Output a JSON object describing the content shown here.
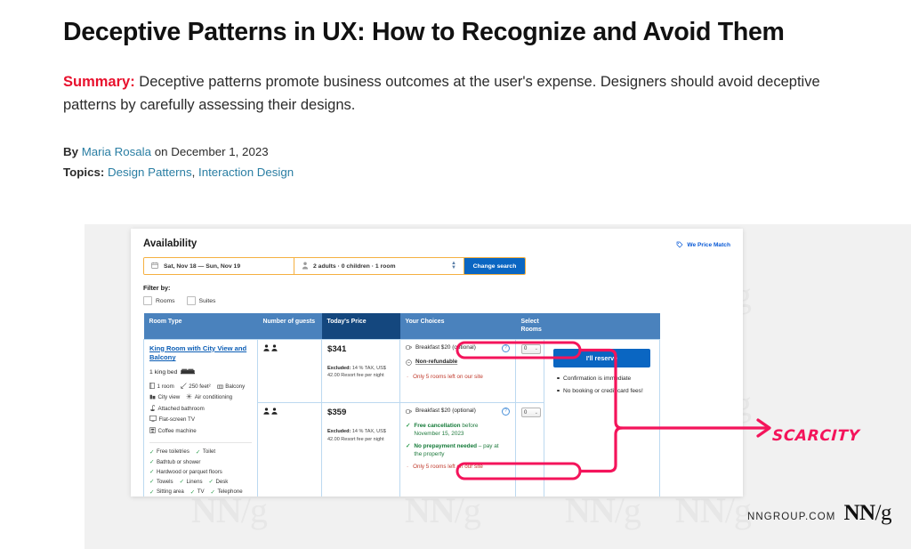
{
  "article": {
    "title": "Deceptive Patterns in UX: How to Recognize and Avoid Them",
    "summary_label": "Summary:",
    "summary_text": " Deceptive patterns promote business outcomes at the user's expense. Designers should avoid deceptive patterns by carefully assessing their designs.",
    "by_label": "By",
    "author": "Maria Rosala",
    "date_prefix": " on ",
    "date": "December 1, 2023",
    "topics_label": "Topics:",
    "topic_1": "Design Patterns",
    "topic_separator": ", ",
    "topic_2": "Interaction Design"
  },
  "brand": {
    "url": "NNGROUP.COM",
    "logo_nn": "NN",
    "logo_slash": "/",
    "logo_g": "g",
    "watermark": "NN",
    "watermark_slash": "/g"
  },
  "annotation": {
    "label": "SCARCITY",
    "color": "#f4145b"
  },
  "screenshot": {
    "availability_title": "Availability",
    "price_match": "We Price Match",
    "search": {
      "dates": "Sat, Nov 18 — Sun, Nov 19",
      "guests": "2 adults · 0 children · 1 room",
      "change_button": "Change search"
    },
    "filter": {
      "title": "Filter by:",
      "options": [
        "Rooms",
        "Suites"
      ]
    },
    "table": {
      "headers": {
        "room_type": "Room Type",
        "guests": "Number of guests",
        "price": "Today's Price",
        "choices": "Your Choices",
        "select": "Select Rooms",
        "actions": ""
      },
      "rows": [
        {
          "room_name": "King Room with City View and Balcony",
          "bed": "1 king bed",
          "amenities_row1": [
            "1 room",
            "250 feet²",
            "Balcony"
          ],
          "amenities_row2": [
            "City view",
            "Air conditioning"
          ],
          "amenities_row3": [
            "Attached bathroom"
          ],
          "amenities_row4": [
            "Flat-screen TV"
          ],
          "amenities_row5": [
            "Coffee machine"
          ],
          "ticks_row1": [
            "Free toiletries",
            "Toilet"
          ],
          "ticks_row2": [
            "Bathtub or shower"
          ],
          "ticks_row3": [
            "Hardwood or parquet floors"
          ],
          "ticks_row4": [
            "Towels",
            "Linens",
            "Desk"
          ],
          "ticks_row5": [
            "Sitting area",
            "TV",
            "Telephone"
          ],
          "price": "$341",
          "price_note_label": "Excluded:",
          "price_note": " 14 % TAX, US$ 42.00 Resort fee per night",
          "choice_breakfast": "Breakfast $20 (optional)",
          "choice_refund": "Non-refundable",
          "scarcity": "Only 5 rooms left on our site",
          "select_value": "0",
          "reserve_button": "I'll reserve",
          "perks": [
            "Confirmation is immediate",
            "No booking or credit card fees!"
          ]
        },
        {
          "price": "$359",
          "price_note_label": "Excluded:",
          "price_note": " 14 % TAX, US$ 42.00 Resort fee per night",
          "choice_breakfast": "Breakfast $20 (optional)",
          "choice_cancel_bold": "Free cancellation",
          "choice_cancel_rest": " before November 15, 2023",
          "choice_prepay_bold": "No prepayment needed",
          "choice_prepay_rest": " – pay at the property",
          "scarcity": "Only 5 rooms left on our site",
          "select_value": "0"
        }
      ]
    }
  }
}
